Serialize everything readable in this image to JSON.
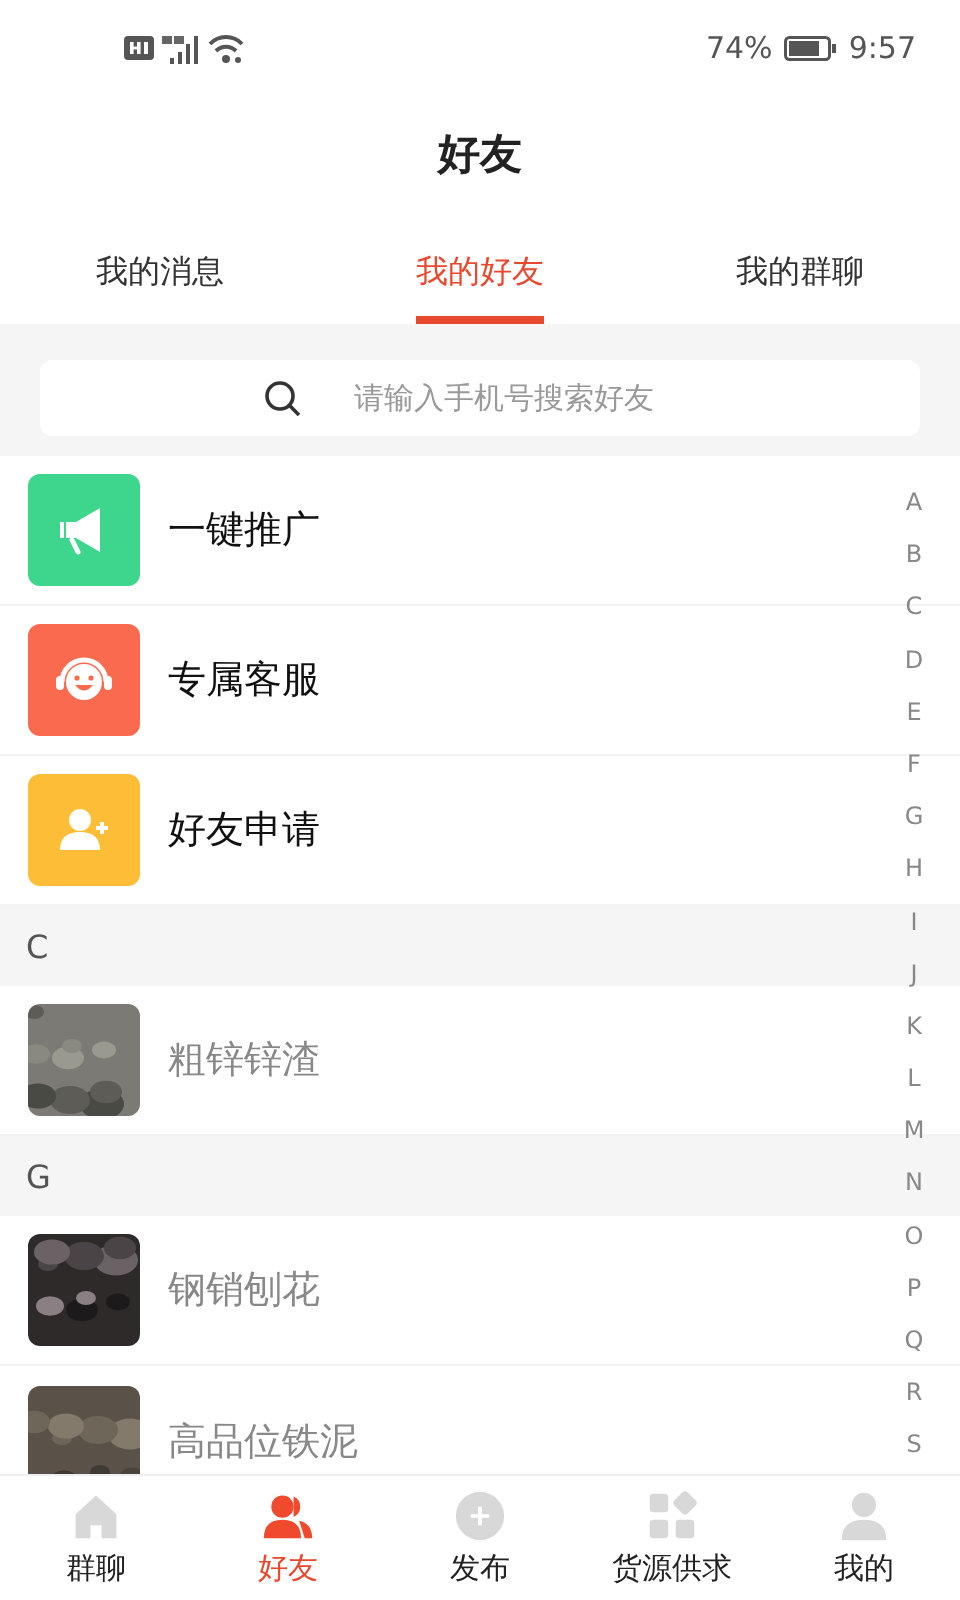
{
  "status_bar": {
    "battery": "74%",
    "time": "9:57"
  },
  "title": "好友",
  "tabs": [
    {
      "label": "我的消息",
      "selected": false
    },
    {
      "label": "我的好友",
      "selected": true
    },
    {
      "label": "我的群聊",
      "selected": false
    }
  ],
  "search": {
    "placeholder": "请输入手机号搜索好友"
  },
  "shortcuts": [
    {
      "label": "一键推广",
      "kind": "megaphone",
      "color": "#3dd68c"
    },
    {
      "label": "专属客服",
      "kind": "headset",
      "color": "#fa6a4f"
    },
    {
      "label": "好友申请",
      "kind": "add-user",
      "color": "#fdbd36"
    }
  ],
  "sections": [
    {
      "letter": "C",
      "friends": [
        {
          "name": "粗锌锌渣",
          "kind": "picture"
        }
      ]
    },
    {
      "letter": "G",
      "friends": [
        {
          "name": "钢销刨花",
          "kind": "picture"
        },
        {
          "name": "高品位铁泥",
          "kind": "picture"
        }
      ]
    }
  ],
  "index_letters": [
    "A",
    "B",
    "C",
    "D",
    "E",
    "F",
    "G",
    "H",
    "I",
    "J",
    "K",
    "L",
    "M",
    "N",
    "O",
    "P",
    "Q",
    "R",
    "S"
  ],
  "bottom_nav": [
    {
      "label": "群聊",
      "kind": "home",
      "selected": false
    },
    {
      "label": "好友",
      "kind": "friends",
      "selected": true
    },
    {
      "label": "发布",
      "kind": "publish",
      "selected": false
    },
    {
      "label": "货源供求",
      "kind": "grid",
      "selected": false
    },
    {
      "label": "我的",
      "kind": "me",
      "selected": false
    }
  ]
}
